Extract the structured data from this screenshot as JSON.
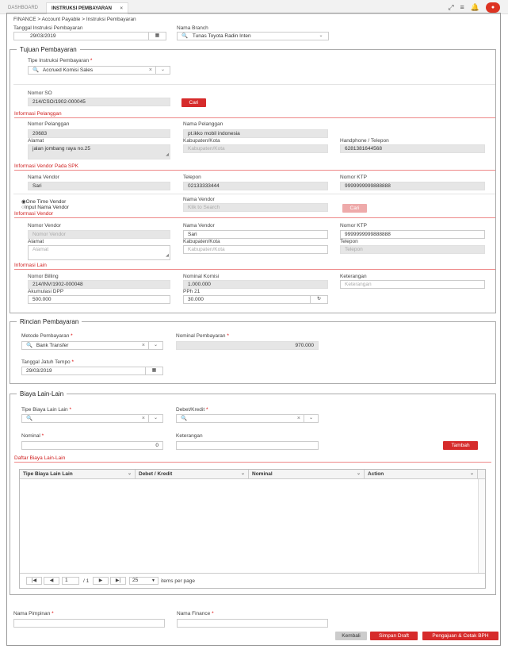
{
  "tabs": {
    "dashboard": "DASHBOARD",
    "active": "INSTRUKSI PEMBAYARAN",
    "close": "×"
  },
  "breadcrumb": {
    "root": "FINANCE",
    "sep1": ">",
    "mid": "Account Payable",
    "sep2": ">",
    "current": "Instruksi Pembayaran"
  },
  "header": {
    "tanggal_label": "Tanggal Instruksi Pembayaran",
    "tanggal_value": "29/03/2019",
    "branch_label": "Nama Branch",
    "branch_value": "Tunas Toyota Radin Inten"
  },
  "tujuan": {
    "legend": "Tujuan Pembayaran",
    "tipe_label": "Tipe Instruksi Pembayaran",
    "tipe_value": "Accrued Komisi Sales",
    "no_so_label": "Nomor SO",
    "no_so_value": "214/CSO/1902-000045",
    "cari": "Cari"
  },
  "pelanggan": {
    "section": "Informasi Pelanggan",
    "nomor_label": "Nomor Pelanggan",
    "nomor_value": "20683",
    "nama_label": "Nama Pelanggan",
    "nama_value": "pt.ikko mobil indonesia",
    "alamat_label": "Alamat",
    "alamat_value": "jalan jombang raya no.25",
    "kab_label": "Kabupaten/Kota",
    "kab_ph": "Kabupaten/Kota",
    "hp_label": "Handphone / Telepon",
    "hp_value": "6281381644568"
  },
  "vendor_spk": {
    "section": "Informasi Vendor Pada SPK",
    "nama_label": "Nama Vendor",
    "nama_value": "Sari",
    "telp_label": "Telepon",
    "telp_value": "02133333444",
    "ktp_label": "Nomor KTP",
    "ktp_value": "9999999999888888"
  },
  "vendor_opt": {
    "one_time": "One Time Vendor",
    "input": "Input Nama Vendor",
    "nama_label": "Nama Vendor",
    "nama_ph": "Klik to Search",
    "cari": "Cari"
  },
  "vendor": {
    "section": "Informasi Vendor",
    "nomor_label": "Nomor Vendor",
    "nomor_ph": "Nomor Vendor",
    "nama_label": "Nama Vendor",
    "nama_value": "Sari",
    "ktp_label": "Nomor KTP",
    "ktp_value": "9999999999888888",
    "alamat_label": "Alamat",
    "alamat_ph": "Alamat",
    "kab_label": "Kabupaten/Kota",
    "kab_ph": "Kabupaten/Kota",
    "telp_label": "Telepon",
    "telp_ph": "Telepon"
  },
  "lain": {
    "section": "Informasi Lain",
    "billing_label": "Nomor Billing",
    "billing_value": "214/INV/1902-000048",
    "komisi_label": "Nominal Komisi",
    "komisi_value": "1.000.000",
    "ket_label": "Keterangan",
    "ket_ph": "Keterangan",
    "dpp_label": "Akumulasi DPP",
    "dpp_value": "500.000",
    "pph_label": "PPh 21",
    "pph_value": "30.000"
  },
  "rincian": {
    "legend": "Rincian Pembayaran",
    "metode_label": "Metode Pembayaran",
    "metode_value": "Bank Transfer",
    "nominal_label": "Nominal Pembayaran",
    "nominal_value": "970.000",
    "jatuh_label": "Tanggal Jatuh Tempo",
    "jatuh_value": "29/03/2019"
  },
  "biaya": {
    "legend": "Biaya Lain-Lain",
    "tipe_label": "Tipe Biaya Lain Lain",
    "debet_label": "Debet/Kredit",
    "nominal_label": "Nominal",
    "nominal_value": "0",
    "ket_label": "Keterangan",
    "tambah": "Tambah",
    "daftar": "Daftar Biaya Lain-Lain",
    "columns": [
      "Tipe Biaya Lain Lain",
      "Debet / Kredit",
      "Nominal",
      "Action"
    ],
    "page_value": "1",
    "page_of": "/ 1",
    "page_size": "25",
    "per_page": "items per page"
  },
  "footer": {
    "pimpinan_label": "Nama Pimpinan",
    "finance_label": "Nama Finance",
    "kembali": "Kembali",
    "simpan": "Simpan Draft",
    "ajukan": "Pengajuan & Cetak BPH"
  },
  "required_mark": "*",
  "colors": {
    "accent": "#d62b2b",
    "section": "#d02020"
  },
  "icons": [
    "expand-icon",
    "menu-icon",
    "bell-icon",
    "avatar",
    "search-icon",
    "calendar-icon",
    "chevron-down-icon",
    "refresh-icon",
    "clear-icon"
  ]
}
